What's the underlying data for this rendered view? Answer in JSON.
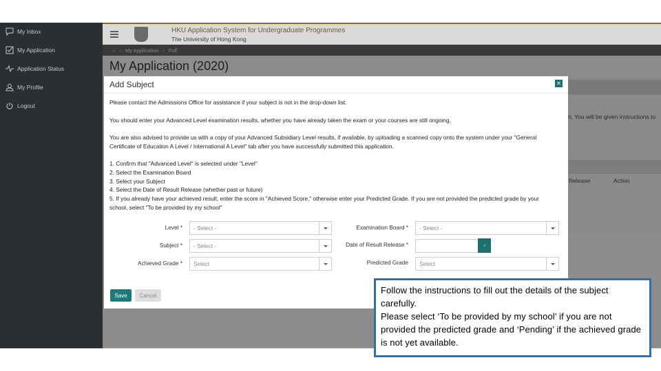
{
  "sidebar": {
    "items": [
      {
        "label": "My Inbox",
        "icon": "chat-icon"
      },
      {
        "label": "My Application",
        "icon": "checkbox-icon"
      },
      {
        "label": "Application Status",
        "icon": "pulse-icon"
      },
      {
        "label": "My Profile",
        "icon": "user-icon"
      },
      {
        "label": "Logout",
        "icon": "logout-icon"
      }
    ]
  },
  "header": {
    "system_title": "HKU Application System for Undergraduate Programmes",
    "university": "The University of Hong Kong",
    "breadcrumb": [
      "My Application",
      "Full"
    ]
  },
  "page": {
    "title": "My Application (2020)",
    "bg_text": "n. You will be given instructions to",
    "bg_col_release": "Release",
    "bg_col_action": "Action"
  },
  "modal": {
    "title": "Add Subject",
    "para1": "Please contact the Admissions Office for assistance if your subject is not in the drop-down list.",
    "para2": "You should enter your Advanced Level examination results, whether you have already taken the exam or your courses are still ongoing.",
    "para3": "You are also advised to provide us with a copy of your Advanced Subsidiary Level results, if available, by uploading a scanned copy onto the system under your \"General Certificate of Education A Level / International A Level\" tab after you have successfully submitted this application.",
    "steps": [
      "1. Confirm that \"Advanced Level\" is selected under \"Level\"",
      "2. Select the Examination Board",
      "3. Select your Subject",
      "4. Select the Date of Result Release (whether past or future)",
      "5. If you already have your achieved result, enter the score in \"Achieved Score,\" otherwise enter your Predicted Grade. If you are not provided the predicted grade by your school, select \"To be provided by my school\""
    ],
    "form": {
      "level_label": "Level *",
      "level_value": "- Select -",
      "subject_label": "Subject *",
      "subject_value": "- Select -",
      "achieved_label": "Achieved Grade *",
      "achieved_value": "Select",
      "board_label": "Examination Board *",
      "board_value": "- Select -",
      "date_label": "Date of Result Release *",
      "date_value": "",
      "predicted_label": "Predicted Grade",
      "predicted_value": "Select"
    },
    "save_label": "Save",
    "cancel_label": "Cancel"
  },
  "callout": {
    "line1": "Follow the instructions to fill out the details of the subject carefully.",
    "line2": "Please select ‘To be provided by my school’ if you are not provided the predicted grade and ‘Pending’ if the achieved grade is not yet available."
  },
  "colors": {
    "accent": "#1e7a78",
    "callout_border": "#2e6fb4",
    "sidebar_bg": "#2b2f32"
  }
}
